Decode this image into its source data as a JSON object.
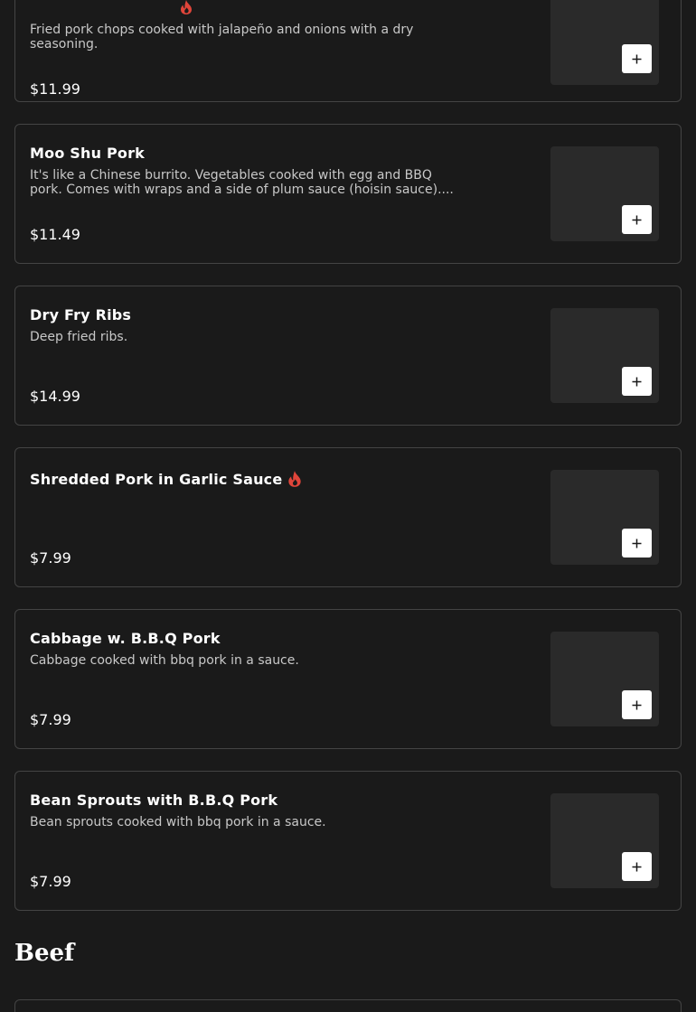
{
  "items": [
    {
      "title": "",
      "description": "Fried pork chops cooked with jalapeño and onions with a dry seasoning.",
      "price": "$11.99",
      "spicy": true,
      "add_icon": "plus-icon"
    },
    {
      "title": "Moo Shu Pork",
      "description": "It's like a Chinese burrito. Vegetables cooked with egg and BBQ pork. Comes with wraps and a side of plum sauce (hoisin sauce)....",
      "price": "$11.49",
      "spicy": false,
      "add_icon": "plus-icon"
    },
    {
      "title": "Dry Fry Ribs",
      "description": "Deep fried ribs.",
      "price": "$14.99",
      "spicy": false,
      "add_icon": "plus-icon"
    },
    {
      "title": "Shredded Pork in Garlic Sauce",
      "description": "",
      "price": "$7.99",
      "spicy": true,
      "add_icon": "plus-icon"
    },
    {
      "title": "Cabbage w. B.B.Q Pork",
      "description": "Cabbage cooked with bbq pork in a sauce.",
      "price": "$7.99",
      "spicy": false,
      "add_icon": "plus-icon"
    },
    {
      "title": "Bean Sprouts with B.B.Q Pork",
      "description": "Bean sprouts cooked with bbq pork in a sauce.",
      "price": "$7.99",
      "spicy": false,
      "add_icon": "plus-icon"
    }
  ],
  "sections": {
    "beef": {
      "heading": "Beef"
    }
  },
  "colors": {
    "background": "#1a1a1a",
    "card_border": "#444444",
    "thumbnail": "#2a2a2a",
    "spicy_flame": "#e0453a",
    "add_button": "#ffffff"
  }
}
